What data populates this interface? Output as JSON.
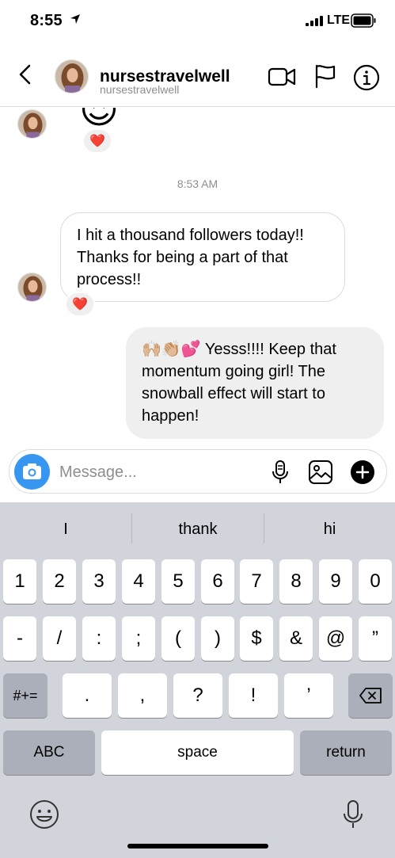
{
  "status_bar": {
    "time": "8:55",
    "network": "LTE"
  },
  "header": {
    "username": "nursestravelwell",
    "subtitle": "nursestravelwell"
  },
  "chat": {
    "top_emoji": "😍",
    "top_reaction": "❤️",
    "timestamp": "8:53 AM",
    "incoming_message": "I hit a thousand followers today!! Thanks for being a part of that process!!",
    "incoming_reaction": "❤️",
    "outgoing_message": "🙌🏼👏🏼💕 Yesss!!!! Keep that momentum going girl! The snowball effect will start to happen!"
  },
  "composer": {
    "placeholder": "Message..."
  },
  "keyboard": {
    "suggestions": [
      "I",
      "thank",
      "hi"
    ],
    "row1": [
      "1",
      "2",
      "3",
      "4",
      "5",
      "6",
      "7",
      "8",
      "9",
      "0"
    ],
    "row2": [
      "-",
      "/",
      ":",
      ";",
      "(",
      ")",
      "$",
      "&",
      "@",
      "”"
    ],
    "row3_shift": "#+=",
    "row3": [
      ".",
      ",",
      "?",
      "!",
      "’"
    ],
    "abc": "ABC",
    "space": "space",
    "return": "return"
  },
  "colors": {
    "accent_blue": "#3797f0",
    "keyboard_bg": "#d2d4db",
    "bubble_out_bg": "#efefef"
  }
}
